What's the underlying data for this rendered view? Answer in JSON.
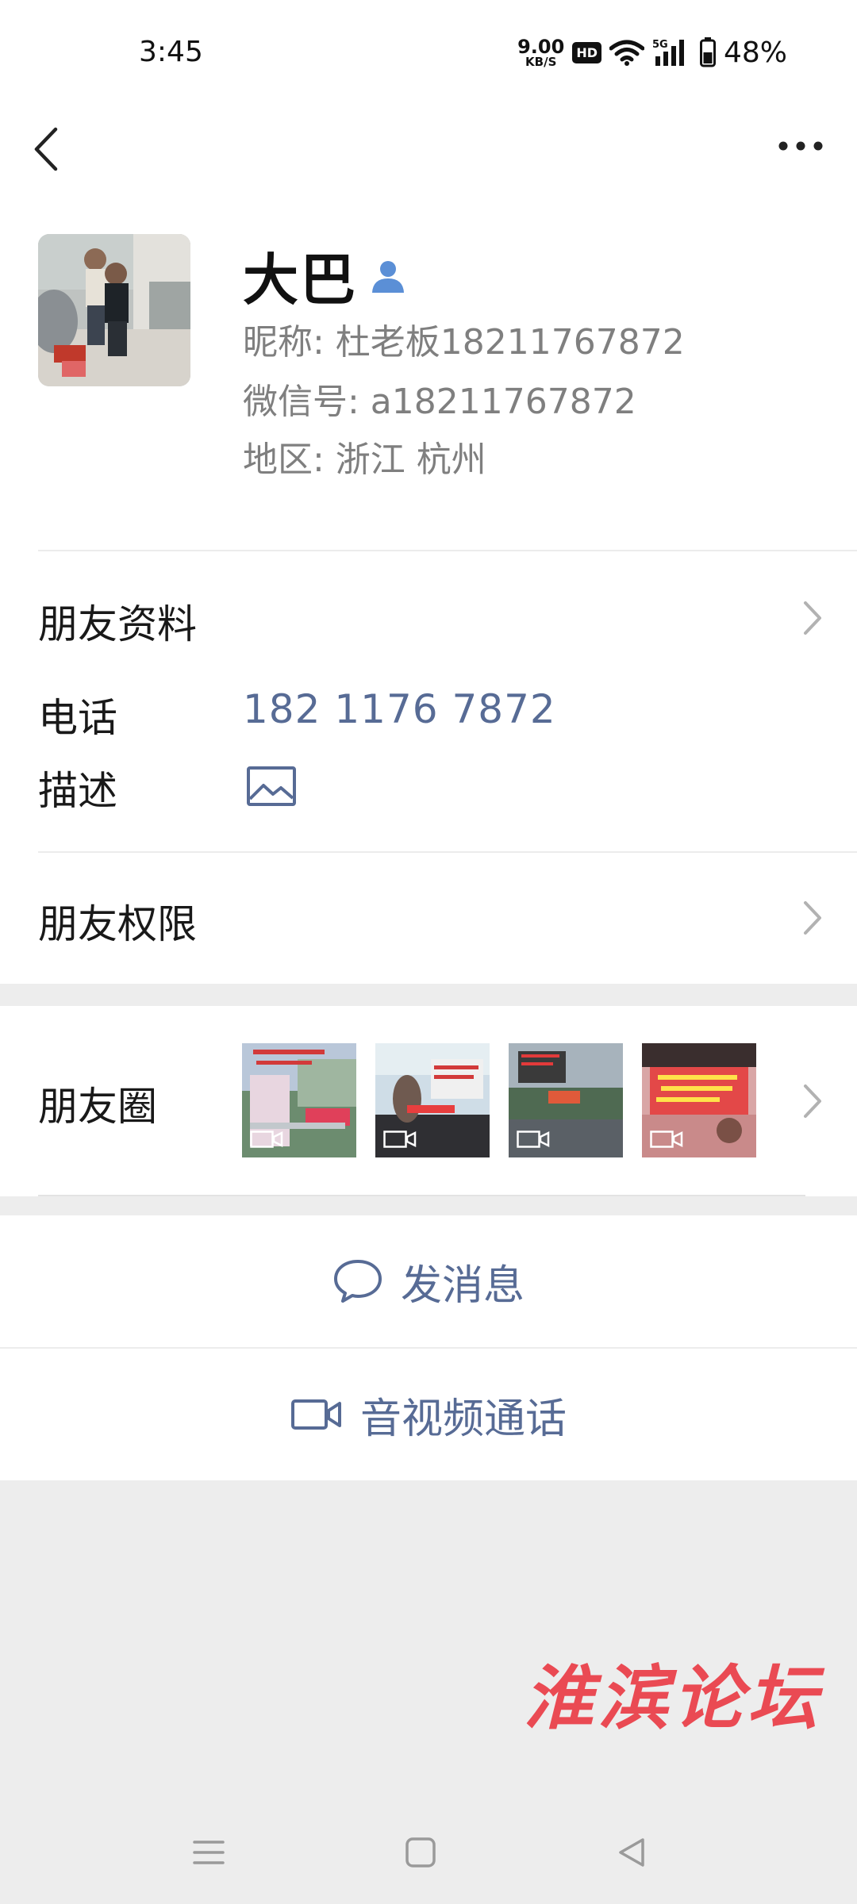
{
  "status_bar": {
    "time": "3:45",
    "net_speed_value": "9.00",
    "net_speed_unit": "KB/S",
    "hd_badge": "HD",
    "network_type": "5G",
    "battery": "48%"
  },
  "nav": {
    "back_icon": "chevron-left-icon",
    "more_icon": "more-dots-icon"
  },
  "profile": {
    "name": "大巴",
    "nickname": "昵称: 杜老板18211767872",
    "wechat_id": "微信号: a18211767872",
    "region": "地区: 浙江  杭州"
  },
  "friend_info": {
    "title": "朋友资料",
    "phone_label": "电话",
    "phone_value": "182 1176 7872",
    "description_label": "描述"
  },
  "permissions": {
    "title": "朋友权限"
  },
  "moments": {
    "title": "朋友圈",
    "thumbnail_count": 4
  },
  "actions": {
    "send_message": "发消息",
    "av_call": "音视频通话"
  },
  "watermark": "淮滨论坛",
  "colors": {
    "link_blue": "#576b95",
    "verify_blue": "#5b8fd6",
    "watermark_red": "#ea4a53"
  }
}
